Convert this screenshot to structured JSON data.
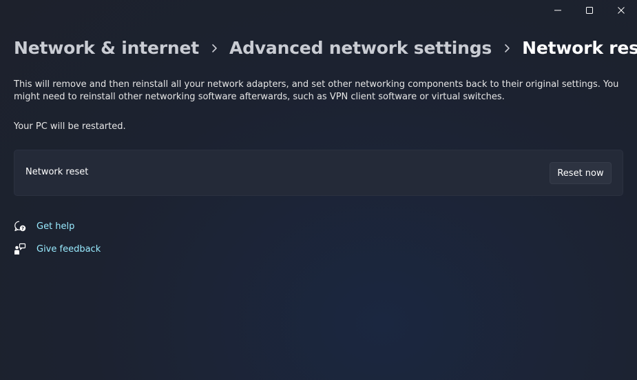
{
  "window": {
    "minimize_icon": "minimize-icon",
    "maximize_icon": "maximize-icon",
    "close_icon": "close-icon"
  },
  "breadcrumb": {
    "items": [
      "Network & internet",
      "Advanced network settings",
      "Network reset"
    ],
    "separator_icon": "chevron-right-icon"
  },
  "description": "This will remove and then reinstall all your network adapters, and set other networking components back to their original settings. You might need to reinstall other networking software afterwards, such as VPN client software or virtual switches.",
  "restart_note": "Your PC will be restarted.",
  "reset_card": {
    "label": "Network reset",
    "button_label": "Reset now"
  },
  "help_links": [
    {
      "label": "Get help",
      "icon": "get-help-icon"
    },
    {
      "label": "Give feedback",
      "icon": "give-feedback-icon"
    }
  ],
  "colors": {
    "background": "#1c2230",
    "card": "#242a38",
    "link": "#99ebff",
    "breadcrumb_inactive": "#c9ccd3",
    "text": "#ffffff"
  }
}
